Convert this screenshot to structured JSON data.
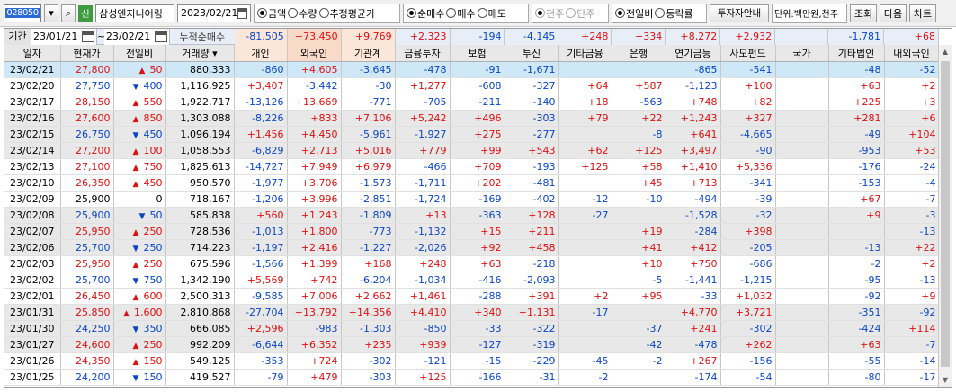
{
  "toolbar": {
    "code": "028050",
    "stock_name": "삼성엔지니어링",
    "badge": "신",
    "date": "2023/02/21",
    "unit_group": [
      "금액",
      "수량",
      "추정평균가"
    ],
    "unit_selected": 0,
    "trade_group": [
      "순매수",
      "매수",
      "매도"
    ],
    "trade_selected": 0,
    "scale_group": [
      "천주",
      "단주"
    ],
    "compare_group": [
      "전일비",
      "등락률"
    ],
    "compare_selected": 0,
    "investor_guide": "투자자안내",
    "unit_text": "단위:백만원,천주",
    "query": "조회",
    "next": "다음",
    "chart": "차트"
  },
  "period": {
    "label": "기간",
    "from": "23/01/21",
    "to": "23/02/21",
    "sum_label": "누적순매수",
    "sums": [
      "-81,505",
      "+73,450",
      "+9,769",
      "+2,323",
      "-194",
      "-4,145",
      "+248",
      "+334",
      "+8,272",
      "+2,932",
      "",
      "-1,781",
      "+68"
    ]
  },
  "columns": [
    "일자",
    "현재가",
    "전일비",
    "거래량",
    "개인",
    "외국인",
    "기관계",
    "금융투자",
    "보험",
    "투신",
    "기타금융",
    "은행",
    "연기금등",
    "사모펀드",
    "국가",
    "기타법인",
    "내외국인"
  ],
  "rows": [
    [
      "23/02/21",
      "27,800",
      "up",
      "50",
      "880,333",
      "-860",
      "+4,605",
      "-3,645",
      "-478",
      "-91",
      "-1,671",
      "",
      "",
      "-865",
      "-541",
      "",
      "-48",
      "-52"
    ],
    [
      "23/02/20",
      "27,750",
      "down",
      "400",
      "1,116,925",
      "+3,407",
      "-3,442",
      "-30",
      "+1,277",
      "-608",
      "-327",
      "+64",
      "+587",
      "-1,123",
      "+100",
      "",
      "+63",
      "+2"
    ],
    [
      "23/02/17",
      "28,150",
      "up",
      "550",
      "1,922,717",
      "-13,126",
      "+13,669",
      "-771",
      "-705",
      "-211",
      "-140",
      "+18",
      "-563",
      "+748",
      "+82",
      "",
      "+225",
      "+3"
    ],
    [
      "23/02/16",
      "27,600",
      "up",
      "850",
      "1,303,088",
      "-8,226",
      "+833",
      "+7,106",
      "+5,242",
      "+496",
      "-303",
      "+79",
      "+22",
      "+1,243",
      "+327",
      "",
      "+281",
      "+6"
    ],
    [
      "23/02/15",
      "26,750",
      "down",
      "450",
      "1,096,194",
      "+1,456",
      "+4,450",
      "-5,961",
      "-1,927",
      "+275",
      "-277",
      "",
      "-8",
      "+641",
      "-4,665",
      "",
      "-49",
      "+104"
    ],
    [
      "23/02/14",
      "27,200",
      "up",
      "100",
      "1,058,553",
      "-6,829",
      "+2,713",
      "+5,016",
      "+779",
      "+99",
      "+543",
      "+62",
      "+125",
      "+3,497",
      "-90",
      "",
      "-953",
      "+53"
    ],
    [
      "23/02/13",
      "27,100",
      "up",
      "750",
      "1,825,613",
      "-14,727",
      "+7,949",
      "+6,979",
      "-466",
      "+709",
      "-193",
      "+125",
      "+58",
      "+1,410",
      "+5,336",
      "",
      "-176",
      "-24"
    ],
    [
      "23/02/10",
      "26,350",
      "up",
      "450",
      "950,570",
      "-1,977",
      "+3,706",
      "-1,573",
      "-1,711",
      "+202",
      "-481",
      "",
      "+45",
      "+713",
      "-341",
      "",
      "-153",
      "-4"
    ],
    [
      "23/02/09",
      "25,900",
      "none",
      "0",
      "718,167",
      "-1,206",
      "+3,996",
      "-2,851",
      "-1,724",
      "-169",
      "-402",
      "-12",
      "-10",
      "-494",
      "-39",
      "",
      "+67",
      "-7"
    ],
    [
      "23/02/08",
      "25,900",
      "down",
      "50",
      "585,838",
      "+560",
      "+1,243",
      "-1,809",
      "+13",
      "-363",
      "+128",
      "-27",
      "",
      "-1,528",
      "-32",
      "",
      "+9",
      "-3"
    ],
    [
      "23/02/07",
      "25,950",
      "up",
      "250",
      "728,536",
      "-1,013",
      "+1,800",
      "-773",
      "-1,132",
      "+15",
      "+211",
      "",
      "+19",
      "-284",
      "+398",
      "",
      "",
      "-13"
    ],
    [
      "23/02/06",
      "25,700",
      "down",
      "250",
      "714,223",
      "-1,197",
      "+2,416",
      "-1,227",
      "-2,026",
      "+92",
      "+458",
      "",
      "+41",
      "+412",
      "-205",
      "",
      "-13",
      "+22"
    ],
    [
      "23/02/03",
      "25,950",
      "up",
      "250",
      "675,596",
      "-1,566",
      "+1,399",
      "+168",
      "+248",
      "+63",
      "-218",
      "",
      "+10",
      "+750",
      "-686",
      "",
      "-2",
      "+2"
    ],
    [
      "23/02/02",
      "25,700",
      "down",
      "750",
      "1,342,190",
      "+5,569",
      "+742",
      "-6,204",
      "-1,034",
      "-416",
      "-2,093",
      "",
      "-5",
      "-1,441",
      "-1,215",
      "",
      "-95",
      "-13"
    ],
    [
      "23/02/01",
      "26,450",
      "up",
      "600",
      "2,500,313",
      "-9,585",
      "+7,006",
      "+2,662",
      "+1,461",
      "-288",
      "+391",
      "+2",
      "+95",
      "-33",
      "+1,032",
      "",
      "-92",
      "+9"
    ],
    [
      "23/01/31",
      "25,850",
      "up",
      "1,600",
      "2,810,868",
      "-27,704",
      "+13,792",
      "+14,356",
      "+4,410",
      "+340",
      "+1,131",
      "-17",
      "",
      "+4,770",
      "+3,721",
      "",
      "-351",
      "-92"
    ],
    [
      "23/01/30",
      "24,250",
      "down",
      "350",
      "666,085",
      "+2,596",
      "-983",
      "-1,303",
      "-850",
      "-33",
      "-322",
      "",
      "-37",
      "+241",
      "-302",
      "",
      "-424",
      "+114"
    ],
    [
      "23/01/27",
      "24,600",
      "up",
      "250",
      "992,209",
      "-6,644",
      "+6,352",
      "+235",
      "+939",
      "-127",
      "-319",
      "",
      "-42",
      "-478",
      "+262",
      "",
      "+63",
      "-7"
    ],
    [
      "23/01/26",
      "24,350",
      "up",
      "150",
      "549,125",
      "-353",
      "+724",
      "-302",
      "-121",
      "-15",
      "-229",
      "-45",
      "-2",
      "+267",
      "-156",
      "",
      "-55",
      "-14"
    ],
    [
      "23/01/25",
      "24,200",
      "down",
      "150",
      "419,527",
      "-79",
      "+479",
      "-303",
      "+125",
      "-166",
      "-31",
      "-2",
      "",
      "-174",
      "-54",
      "",
      "-80",
      "-17"
    ]
  ]
}
